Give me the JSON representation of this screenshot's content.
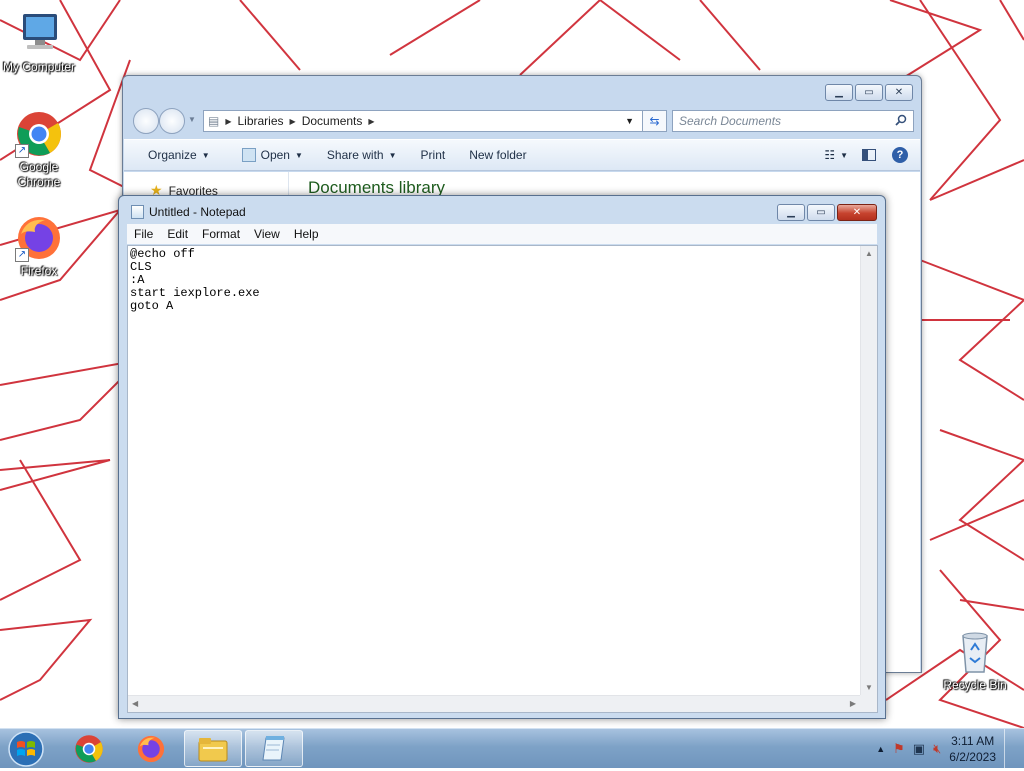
{
  "desktop": {
    "icons": [
      {
        "label": "My Computer",
        "icon": "computer-icon"
      },
      {
        "label": "Google Chrome",
        "icon": "chrome-icon"
      },
      {
        "label": "Firefox",
        "icon": "firefox-icon"
      },
      {
        "label": "Recycle Bin",
        "icon": "recycle-bin-icon"
      }
    ]
  },
  "explorer": {
    "breadcrumb": [
      "Libraries",
      "Documents"
    ],
    "search_placeholder": "Search Documents",
    "toolbar": {
      "organize": "Organize",
      "open": "Open",
      "share_with": "Share with",
      "print": "Print",
      "new_folder": "New folder"
    },
    "nav": {
      "favorites": "Favorites"
    },
    "library_title": "Documents library"
  },
  "notepad": {
    "title": "Untitled - Notepad",
    "menu": [
      "File",
      "Edit",
      "Format",
      "View",
      "Help"
    ],
    "content": "@echo off\nCLS\n:A\nstart iexplore.exe\ngoto A"
  },
  "taskbar": {
    "clock_time": "3:11 AM",
    "clock_date": "6/2/2023",
    "buttons": [
      "chrome-icon",
      "firefox-icon",
      "explorer-icon",
      "notepad-icon"
    ]
  },
  "colors": {
    "wallpaper_lines": "#cc1f2a",
    "library_title": "#1e5c1e",
    "taskbar": "#7ea2c7"
  }
}
